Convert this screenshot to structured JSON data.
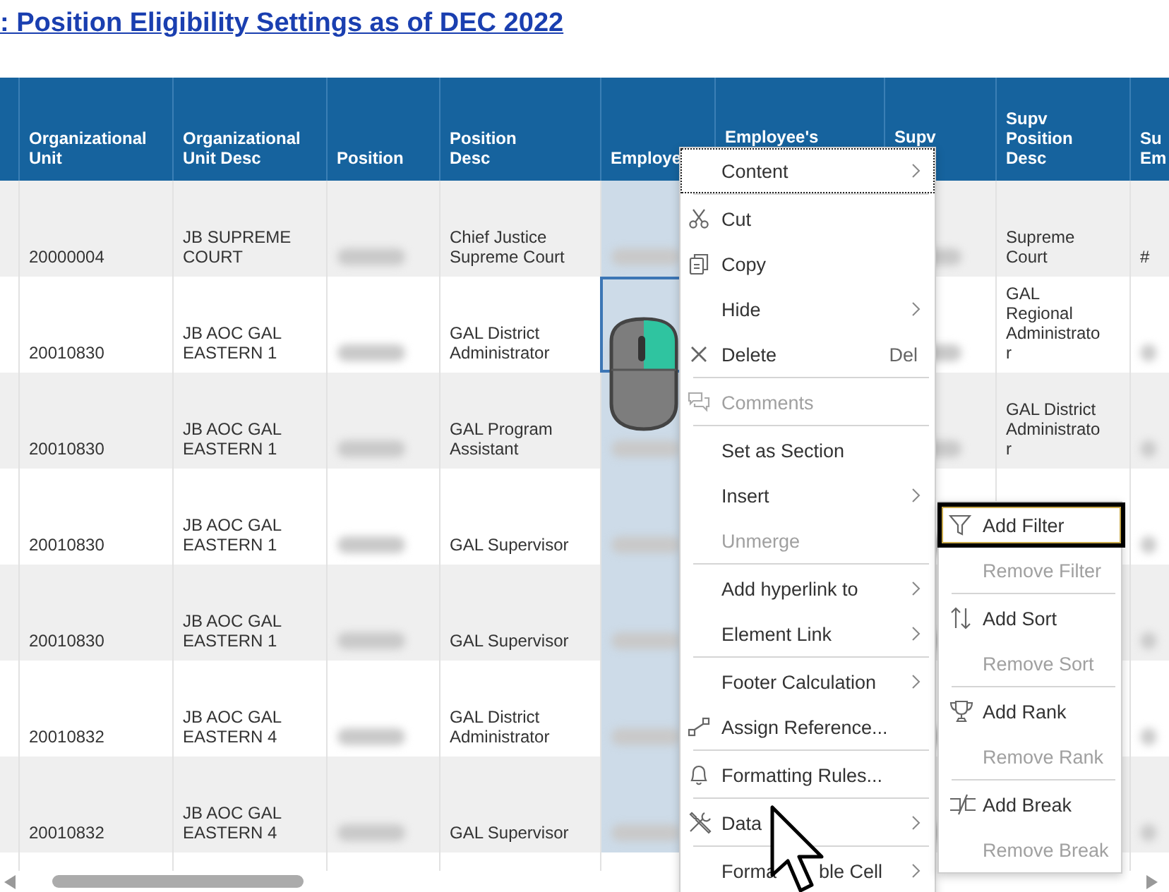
{
  "title": ": Position Eligibility Settings as of DEC 2022",
  "table": {
    "columns": [
      {
        "highlighted": false
      },
      {
        "label": "Organizational\nUnit",
        "highlighted": false
      },
      {
        "label": "Organizational\nUnit Desc",
        "highlighted": false
      },
      {
        "label": "Position",
        "highlighted": false
      },
      {
        "label": "Position\nDesc",
        "highlighted": false
      },
      {
        "label": "Employe",
        "highlighted": true
      },
      {
        "label": "Employee's",
        "highlighted": false
      },
      {
        "label": "Supv",
        "highlighted": false
      },
      {
        "label": "Supv\nPosition\nDesc",
        "highlighted": false
      },
      {
        "label": "Su\nEm",
        "highlighted": false
      }
    ],
    "rows": [
      {
        "org_unit": "20000004",
        "org_unit_desc": "JB SUPREME\nCOURT",
        "position_desc": "Chief Justice\nSupreme Court",
        "supv_position_desc": "Supreme\nCourt",
        "supv_employee": "#",
        "selected": false
      },
      {
        "org_unit": "20010830",
        "org_unit_desc": "JB AOC GAL\nEASTERN 1",
        "position_desc": "GAL District\nAdministrator",
        "supv_position_desc": "GAL\nRegional\nAdministrato\nr",
        "selected": true
      },
      {
        "org_unit": "20010830",
        "org_unit_desc": "JB AOC GAL\nEASTERN 1",
        "position_desc": "GAL Program\nAssistant",
        "supv_position_desc": "GAL District\nAdministrato\nr",
        "selected": false
      },
      {
        "org_unit": "20010830",
        "org_unit_desc": "JB AOC GAL\nEASTERN 1",
        "position_desc": "GAL Supervisor",
        "selected": false
      },
      {
        "org_unit": "20010830",
        "org_unit_desc": "JB AOC GAL\nEASTERN 1",
        "position_desc": "GAL Supervisor",
        "selected": false
      },
      {
        "org_unit": "20010832",
        "org_unit_desc": "JB AOC GAL\nEASTERN 4",
        "position_desc": "GAL District\nAdministrator",
        "selected": false
      },
      {
        "org_unit": "20010832",
        "org_unit_desc": "JB AOC GAL\nEASTERN 4",
        "position_desc": "GAL Supervisor",
        "selected": false
      }
    ]
  },
  "context_menu": {
    "items": [
      {
        "kind": "item",
        "label": "Content",
        "submenu": true,
        "focused": true,
        "disabled": false
      },
      {
        "kind": "separator"
      },
      {
        "kind": "item",
        "label": "Cut",
        "submenu": false,
        "focused": false,
        "disabled": false
      },
      {
        "kind": "item",
        "label": "Copy",
        "submenu": false,
        "focused": false,
        "disabled": false
      },
      {
        "kind": "item",
        "label": "Hide",
        "submenu": true,
        "focused": false,
        "disabled": false
      },
      {
        "kind": "item",
        "label": "Delete",
        "shortcut": "Del",
        "submenu": false,
        "focused": false,
        "disabled": false
      },
      {
        "kind": "separator"
      },
      {
        "kind": "item",
        "label": "Comments",
        "submenu": false,
        "focused": false,
        "disabled": true
      },
      {
        "kind": "separator"
      },
      {
        "kind": "item",
        "label": "Set as Section",
        "submenu": false,
        "focused": false,
        "disabled": false
      },
      {
        "kind": "item",
        "label": "Insert",
        "submenu": true,
        "focused": false,
        "disabled": false
      },
      {
        "kind": "item",
        "label": "Unmerge",
        "submenu": false,
        "focused": false,
        "disabled": true
      },
      {
        "kind": "separator"
      },
      {
        "kind": "item",
        "label": "Add hyperlink to",
        "submenu": true,
        "focused": false,
        "disabled": false
      },
      {
        "kind": "item",
        "label": "Element Link",
        "submenu": true,
        "focused": false,
        "disabled": false
      },
      {
        "kind": "separator"
      },
      {
        "kind": "item",
        "label": "Footer Calculation",
        "submenu": true,
        "focused": false,
        "disabled": false
      },
      {
        "kind": "item",
        "label": "Assign Reference...",
        "submenu": false,
        "focused": false,
        "disabled": false
      },
      {
        "kind": "separator"
      },
      {
        "kind": "item",
        "label": "Formatting Rules...",
        "submenu": false,
        "focused": false,
        "disabled": false
      },
      {
        "kind": "separator"
      },
      {
        "kind": "item",
        "label": "Data",
        "submenu": true,
        "focused": false,
        "disabled": false
      },
      {
        "kind": "separator"
      },
      {
        "kind": "item",
        "label": "Forma",
        "label_after_cursor": "ble Cell",
        "submenu": true,
        "focused": false,
        "disabled": false
      }
    ]
  },
  "submenu": {
    "items": [
      {
        "kind": "item",
        "label": "Add Filter",
        "focused": true,
        "disabled": false
      },
      {
        "kind": "item",
        "label": "Remove Filter",
        "focused": false,
        "disabled": true
      },
      {
        "kind": "separator"
      },
      {
        "kind": "item",
        "label": "Add Sort",
        "focused": false,
        "disabled": false
      },
      {
        "kind": "item",
        "label": "Remove Sort",
        "focused": false,
        "disabled": true
      },
      {
        "kind": "separator"
      },
      {
        "kind": "item",
        "label": "Add Rank",
        "focused": false,
        "disabled": false
      },
      {
        "kind": "item",
        "label": "Remove Rank",
        "focused": false,
        "disabled": true
      },
      {
        "kind": "separator"
      },
      {
        "kind": "item",
        "label": "Add Break",
        "focused": false,
        "disabled": false
      },
      {
        "kind": "item",
        "label": "Remove Break",
        "focused": false,
        "disabled": true
      }
    ]
  }
}
